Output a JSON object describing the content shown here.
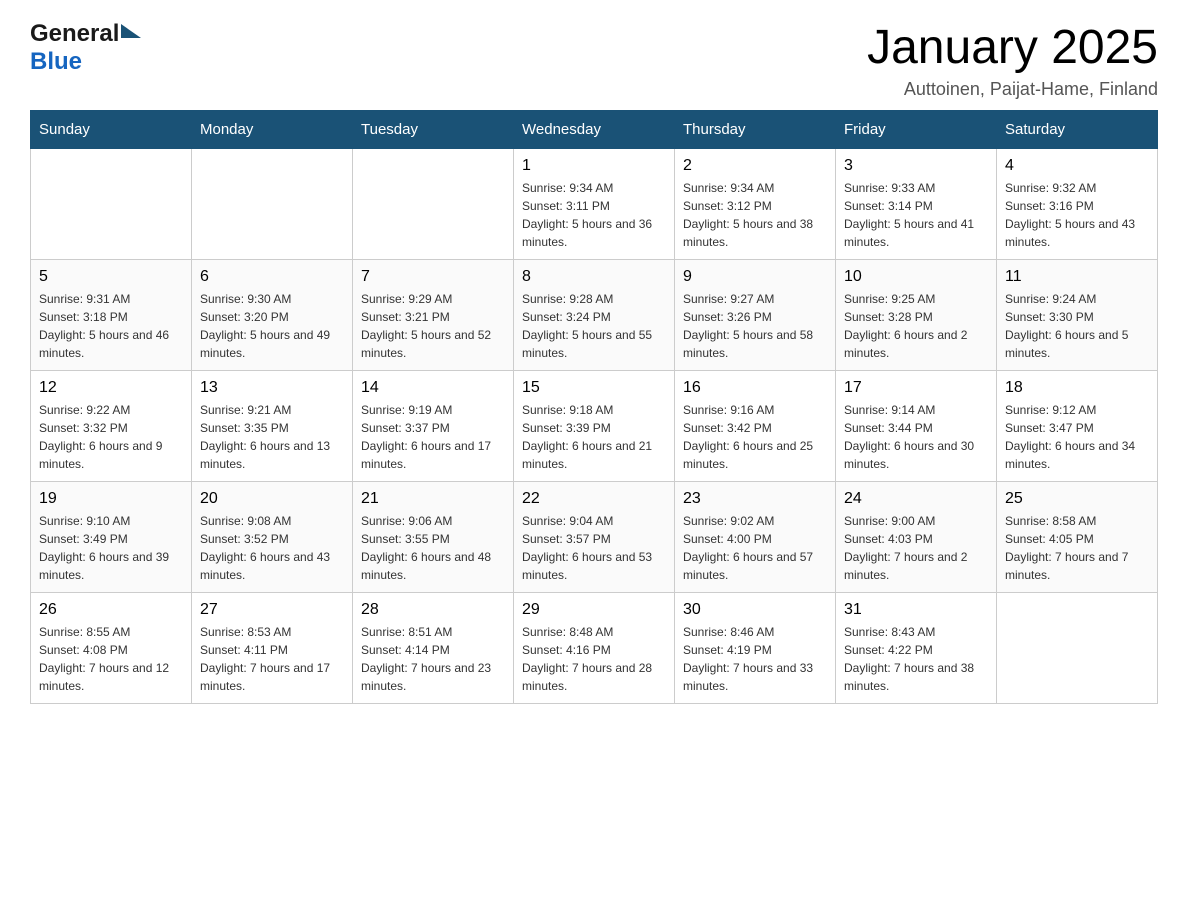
{
  "header": {
    "title": "January 2025",
    "subtitle": "Auttoinen, Paijat-Hame, Finland",
    "logo_general": "General",
    "logo_blue": "Blue"
  },
  "days_of_week": [
    "Sunday",
    "Monday",
    "Tuesday",
    "Wednesday",
    "Thursday",
    "Friday",
    "Saturday"
  ],
  "weeks": [
    [
      {
        "date": "",
        "sunrise": "",
        "sunset": "",
        "daylight": ""
      },
      {
        "date": "",
        "sunrise": "",
        "sunset": "",
        "daylight": ""
      },
      {
        "date": "",
        "sunrise": "",
        "sunset": "",
        "daylight": ""
      },
      {
        "date": "1",
        "sunrise": "Sunrise: 9:34 AM",
        "sunset": "Sunset: 3:11 PM",
        "daylight": "Daylight: 5 hours and 36 minutes."
      },
      {
        "date": "2",
        "sunrise": "Sunrise: 9:34 AM",
        "sunset": "Sunset: 3:12 PM",
        "daylight": "Daylight: 5 hours and 38 minutes."
      },
      {
        "date": "3",
        "sunrise": "Sunrise: 9:33 AM",
        "sunset": "Sunset: 3:14 PM",
        "daylight": "Daylight: 5 hours and 41 minutes."
      },
      {
        "date": "4",
        "sunrise": "Sunrise: 9:32 AM",
        "sunset": "Sunset: 3:16 PM",
        "daylight": "Daylight: 5 hours and 43 minutes."
      }
    ],
    [
      {
        "date": "5",
        "sunrise": "Sunrise: 9:31 AM",
        "sunset": "Sunset: 3:18 PM",
        "daylight": "Daylight: 5 hours and 46 minutes."
      },
      {
        "date": "6",
        "sunrise": "Sunrise: 9:30 AM",
        "sunset": "Sunset: 3:20 PM",
        "daylight": "Daylight: 5 hours and 49 minutes."
      },
      {
        "date": "7",
        "sunrise": "Sunrise: 9:29 AM",
        "sunset": "Sunset: 3:21 PM",
        "daylight": "Daylight: 5 hours and 52 minutes."
      },
      {
        "date": "8",
        "sunrise": "Sunrise: 9:28 AM",
        "sunset": "Sunset: 3:24 PM",
        "daylight": "Daylight: 5 hours and 55 minutes."
      },
      {
        "date": "9",
        "sunrise": "Sunrise: 9:27 AM",
        "sunset": "Sunset: 3:26 PM",
        "daylight": "Daylight: 5 hours and 58 minutes."
      },
      {
        "date": "10",
        "sunrise": "Sunrise: 9:25 AM",
        "sunset": "Sunset: 3:28 PM",
        "daylight": "Daylight: 6 hours and 2 minutes."
      },
      {
        "date": "11",
        "sunrise": "Sunrise: 9:24 AM",
        "sunset": "Sunset: 3:30 PM",
        "daylight": "Daylight: 6 hours and 5 minutes."
      }
    ],
    [
      {
        "date": "12",
        "sunrise": "Sunrise: 9:22 AM",
        "sunset": "Sunset: 3:32 PM",
        "daylight": "Daylight: 6 hours and 9 minutes."
      },
      {
        "date": "13",
        "sunrise": "Sunrise: 9:21 AM",
        "sunset": "Sunset: 3:35 PM",
        "daylight": "Daylight: 6 hours and 13 minutes."
      },
      {
        "date": "14",
        "sunrise": "Sunrise: 9:19 AM",
        "sunset": "Sunset: 3:37 PM",
        "daylight": "Daylight: 6 hours and 17 minutes."
      },
      {
        "date": "15",
        "sunrise": "Sunrise: 9:18 AM",
        "sunset": "Sunset: 3:39 PM",
        "daylight": "Daylight: 6 hours and 21 minutes."
      },
      {
        "date": "16",
        "sunrise": "Sunrise: 9:16 AM",
        "sunset": "Sunset: 3:42 PM",
        "daylight": "Daylight: 6 hours and 25 minutes."
      },
      {
        "date": "17",
        "sunrise": "Sunrise: 9:14 AM",
        "sunset": "Sunset: 3:44 PM",
        "daylight": "Daylight: 6 hours and 30 minutes."
      },
      {
        "date": "18",
        "sunrise": "Sunrise: 9:12 AM",
        "sunset": "Sunset: 3:47 PM",
        "daylight": "Daylight: 6 hours and 34 minutes."
      }
    ],
    [
      {
        "date": "19",
        "sunrise": "Sunrise: 9:10 AM",
        "sunset": "Sunset: 3:49 PM",
        "daylight": "Daylight: 6 hours and 39 minutes."
      },
      {
        "date": "20",
        "sunrise": "Sunrise: 9:08 AM",
        "sunset": "Sunset: 3:52 PM",
        "daylight": "Daylight: 6 hours and 43 minutes."
      },
      {
        "date": "21",
        "sunrise": "Sunrise: 9:06 AM",
        "sunset": "Sunset: 3:55 PM",
        "daylight": "Daylight: 6 hours and 48 minutes."
      },
      {
        "date": "22",
        "sunrise": "Sunrise: 9:04 AM",
        "sunset": "Sunset: 3:57 PM",
        "daylight": "Daylight: 6 hours and 53 minutes."
      },
      {
        "date": "23",
        "sunrise": "Sunrise: 9:02 AM",
        "sunset": "Sunset: 4:00 PM",
        "daylight": "Daylight: 6 hours and 57 minutes."
      },
      {
        "date": "24",
        "sunrise": "Sunrise: 9:00 AM",
        "sunset": "Sunset: 4:03 PM",
        "daylight": "Daylight: 7 hours and 2 minutes."
      },
      {
        "date": "25",
        "sunrise": "Sunrise: 8:58 AM",
        "sunset": "Sunset: 4:05 PM",
        "daylight": "Daylight: 7 hours and 7 minutes."
      }
    ],
    [
      {
        "date": "26",
        "sunrise": "Sunrise: 8:55 AM",
        "sunset": "Sunset: 4:08 PM",
        "daylight": "Daylight: 7 hours and 12 minutes."
      },
      {
        "date": "27",
        "sunrise": "Sunrise: 8:53 AM",
        "sunset": "Sunset: 4:11 PM",
        "daylight": "Daylight: 7 hours and 17 minutes."
      },
      {
        "date": "28",
        "sunrise": "Sunrise: 8:51 AM",
        "sunset": "Sunset: 4:14 PM",
        "daylight": "Daylight: 7 hours and 23 minutes."
      },
      {
        "date": "29",
        "sunrise": "Sunrise: 8:48 AM",
        "sunset": "Sunset: 4:16 PM",
        "daylight": "Daylight: 7 hours and 28 minutes."
      },
      {
        "date": "30",
        "sunrise": "Sunrise: 8:46 AM",
        "sunset": "Sunset: 4:19 PM",
        "daylight": "Daylight: 7 hours and 33 minutes."
      },
      {
        "date": "31",
        "sunrise": "Sunrise: 8:43 AM",
        "sunset": "Sunset: 4:22 PM",
        "daylight": "Daylight: 7 hours and 38 minutes."
      },
      {
        "date": "",
        "sunrise": "",
        "sunset": "",
        "daylight": ""
      }
    ]
  ]
}
